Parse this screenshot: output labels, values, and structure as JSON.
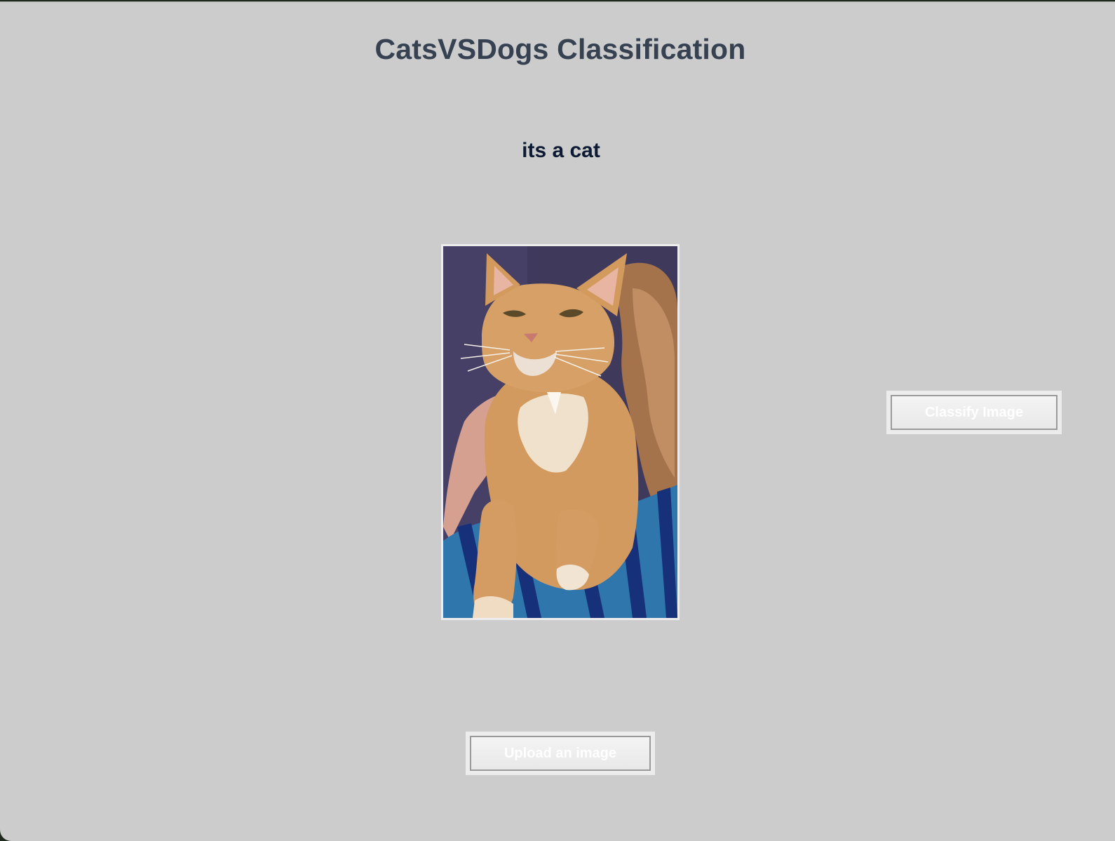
{
  "app": {
    "title": "CatsVSDogs Classification"
  },
  "result": {
    "text": "its a cat"
  },
  "preview": {
    "subject": "cat photo"
  },
  "buttons": {
    "classify_label": "Classify Image",
    "upload_label": "Upload an image"
  },
  "colors": {
    "background": "#cccccc",
    "title": "#364152",
    "result": "#0c1a33",
    "button_text": "#ffffff"
  }
}
